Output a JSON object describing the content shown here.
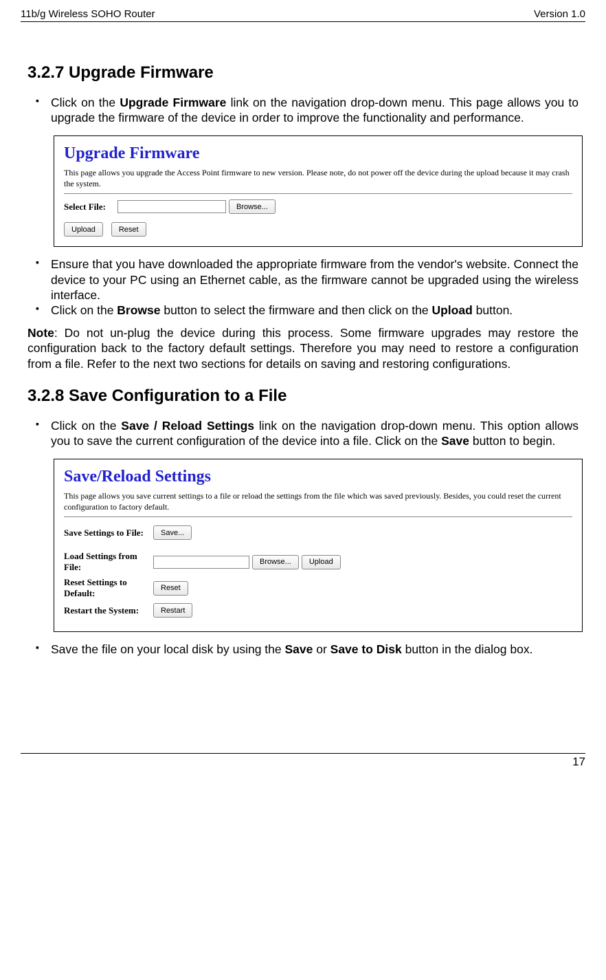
{
  "header": {
    "left": "11b/g Wireless SOHO Router",
    "right": "Version 1.0"
  },
  "s327": {
    "title": "3.2.7 Upgrade Firmware",
    "p1a": "Click on the ",
    "p1b": "Upgrade Firmware",
    "p1c": " link on the navigation drop-down menu. This page allows you to upgrade the firmware of the device in order to improve the functionality and performance.",
    "p2": "Ensure that you have downloaded the appropriate firmware from the vendor's website. Connect the device to your PC using an Ethernet cable, as the firmware cannot be upgraded using the wireless interface.",
    "p3a": "Click on the ",
    "p3b": "Browse",
    "p3c": " button to select the firmware and then click on the ",
    "p3d": "Upload",
    "p3e": " button.",
    "noteLabel": "Note",
    "note": ": Do not un-plug the device during this process. Some firmware upgrades may restore the configuration back to the factory default settings. Therefore you may need to restore a configuration from a file. Refer to the next two sections for details on saving and restoring configurations."
  },
  "s328": {
    "title": "3.2.8 Save Configuration to a File",
    "p1a": "Click on the ",
    "p1b": "Save / Reload Settings",
    "p1c": " link on the navigation drop-down menu. This option allows you to save the current configuration of the device into a file. Click on the ",
    "p1d": "Save",
    "p1e": " button to begin.",
    "p2a": "Save the file on your local disk by using the ",
    "p2b": "Save",
    "p2c": " or ",
    "p2d": "Save to Disk",
    "p2e": " button in the dialog box."
  },
  "shot1": {
    "title": "Upgrade Firmware",
    "desc": "This page allows you upgrade the Access Point firmware to new version. Please note, do not power off the device during the upload because it may crash the system.",
    "label": "Select File:",
    "browse": "Browse...",
    "upload": "Upload",
    "reset": "Reset"
  },
  "shot2": {
    "title": "Save/Reload Settings",
    "desc": "This page allows you save current settings to a file or reload the settings from the file which was saved previously. Besides, you could reset the current configuration to factory default.",
    "rowSaveLabel": "Save Settings to File:",
    "rowLoadLabel": "Load Settings from File:",
    "rowResetLabel": "Reset Settings to Default:",
    "rowRestartLabel": "Restart the System:",
    "saveBtn": "Save...",
    "browse": "Browse...",
    "upload": "Upload",
    "reset": "Reset",
    "restart": "Restart"
  },
  "footer": {
    "page": "17"
  }
}
